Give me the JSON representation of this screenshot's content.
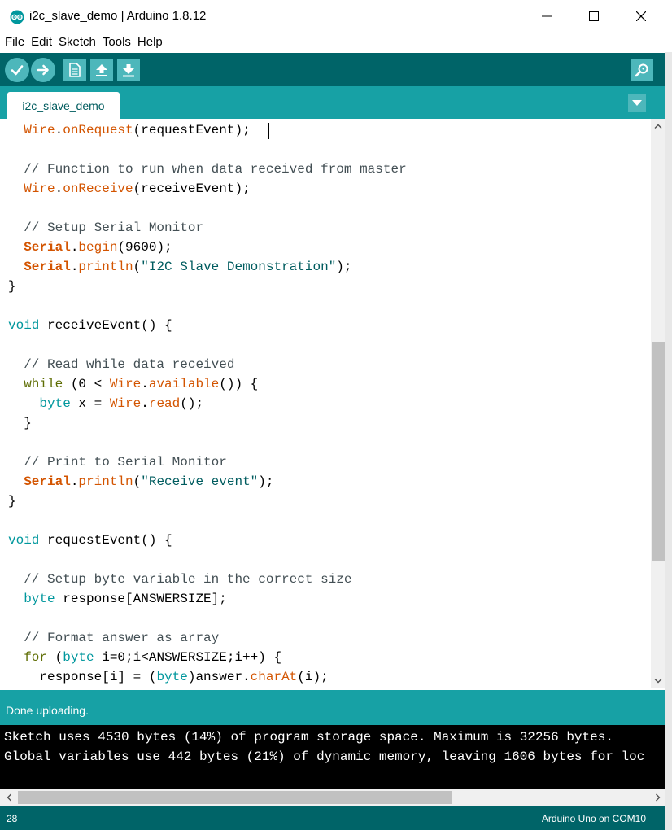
{
  "window": {
    "title": "i2c_slave_demo | Arduino 1.8.12",
    "app_icon": "arduino-logo-icon",
    "controls": [
      "minimize-icon",
      "maximize-icon",
      "close-icon"
    ]
  },
  "menu": {
    "items": [
      {
        "label": "File"
      },
      {
        "label": "Edit"
      },
      {
        "label": "Sketch"
      },
      {
        "label": "Tools"
      },
      {
        "label": "Help"
      }
    ]
  },
  "toolbar": {
    "buttons": [
      {
        "icon": "checkmark-icon",
        "action": "verify"
      },
      {
        "icon": "arrow-right-icon",
        "action": "upload"
      },
      {
        "icon": "new-file-icon",
        "action": "new"
      },
      {
        "icon": "arrow-up-icon",
        "action": "open"
      },
      {
        "icon": "arrow-down-icon",
        "action": "save"
      }
    ],
    "serial_monitor_icon": "magnifier-icon"
  },
  "tabs": {
    "active": "i2c_slave_demo",
    "menu_icon": "triangle-down-icon"
  },
  "editor": {
    "lines": [
      [
        {
          "c": "  "
        },
        {
          "c": "Wire",
          "k": "kw-obj"
        },
        {
          "c": "."
        },
        {
          "c": "onRequest",
          "k": "kw-obj"
        },
        {
          "c": "(requestEvent);"
        }
      ],
      [
        {
          "c": ""
        }
      ],
      [
        {
          "c": "  "
        },
        {
          "c": "// Function to run when data received from master",
          "k": "cm"
        }
      ],
      [
        {
          "c": "  "
        },
        {
          "c": "Wire",
          "k": "kw-obj"
        },
        {
          "c": "."
        },
        {
          "c": "onReceive",
          "k": "kw-obj"
        },
        {
          "c": "(receiveEvent);"
        }
      ],
      [
        {
          "c": ""
        }
      ],
      [
        {
          "c": "  "
        },
        {
          "c": "// Setup Serial Monitor",
          "k": "cm"
        }
      ],
      [
        {
          "c": "  "
        },
        {
          "c": "Serial",
          "k": "kw-obj-b"
        },
        {
          "c": "."
        },
        {
          "c": "begin",
          "k": "kw-obj"
        },
        {
          "c": "(9600);"
        }
      ],
      [
        {
          "c": "  "
        },
        {
          "c": "Serial",
          "k": "kw-obj-b"
        },
        {
          "c": "."
        },
        {
          "c": "println",
          "k": "kw-obj"
        },
        {
          "c": "("
        },
        {
          "c": "\"I2C Slave Demonstration\"",
          "k": "str"
        },
        {
          "c": ");"
        }
      ],
      [
        {
          "c": "}"
        }
      ],
      [
        {
          "c": ""
        }
      ],
      [
        {
          "c": "void",
          "k": "kw-type"
        },
        {
          "c": " receiveEvent() {"
        }
      ],
      [
        {
          "c": ""
        }
      ],
      [
        {
          "c": "  "
        },
        {
          "c": "// Read while data received",
          "k": "cm"
        }
      ],
      [
        {
          "c": "  "
        },
        {
          "c": "while",
          "k": "kw-ctl"
        },
        {
          "c": " (0 < "
        },
        {
          "c": "Wire",
          "k": "kw-obj"
        },
        {
          "c": "."
        },
        {
          "c": "available",
          "k": "kw-obj"
        },
        {
          "c": "()) {"
        }
      ],
      [
        {
          "c": "    "
        },
        {
          "c": "byte",
          "k": "kw-type"
        },
        {
          "c": " x = "
        },
        {
          "c": "Wire",
          "k": "kw-obj"
        },
        {
          "c": "."
        },
        {
          "c": "read",
          "k": "kw-obj"
        },
        {
          "c": "();"
        }
      ],
      [
        {
          "c": "  }"
        }
      ],
      [
        {
          "c": ""
        }
      ],
      [
        {
          "c": "  "
        },
        {
          "c": "// Print to Serial Monitor",
          "k": "cm"
        }
      ],
      [
        {
          "c": "  "
        },
        {
          "c": "Serial",
          "k": "kw-obj-b"
        },
        {
          "c": "."
        },
        {
          "c": "println",
          "k": "kw-obj"
        },
        {
          "c": "("
        },
        {
          "c": "\"Receive event\"",
          "k": "str"
        },
        {
          "c": ");"
        }
      ],
      [
        {
          "c": "}"
        }
      ],
      [
        {
          "c": ""
        }
      ],
      [
        {
          "c": "void",
          "k": "kw-type"
        },
        {
          "c": " requestEvent() {"
        }
      ],
      [
        {
          "c": ""
        }
      ],
      [
        {
          "c": "  "
        },
        {
          "c": "// Setup byte variable in the correct size",
          "k": "cm"
        }
      ],
      [
        {
          "c": "  "
        },
        {
          "c": "byte",
          "k": "kw-type"
        },
        {
          "c": " response[ANSWERSIZE];"
        }
      ],
      [
        {
          "c": ""
        }
      ],
      [
        {
          "c": "  "
        },
        {
          "c": "// Format answer as array",
          "k": "cm"
        }
      ],
      [
        {
          "c": "  "
        },
        {
          "c": "for",
          "k": "kw-ctl"
        },
        {
          "c": " ("
        },
        {
          "c": "byte",
          "k": "kw-type"
        },
        {
          "c": " i=0;i<ANSWERSIZE;i++) {"
        }
      ],
      [
        {
          "c": "    response[i] = ("
        },
        {
          "c": "byte",
          "k": "kw-type"
        },
        {
          "c": ")answer."
        },
        {
          "c": "charAt",
          "k": "kw-obj"
        },
        {
          "c": "(i);"
        }
      ]
    ]
  },
  "status": {
    "message": "Done uploading."
  },
  "console": {
    "lines": [
      "Sketch uses 4530 bytes (14%) of program storage space. Maximum is 32256 bytes.",
      "Global variables use 442 bytes (21%) of dynamic memory, leaving 1606 bytes for loc"
    ]
  },
  "footer": {
    "line_number": "28",
    "board": "Arduino Uno on COM10"
  },
  "colors": {
    "toolbar": "#006468",
    "tabstrip": "#17a1a5",
    "button": "#4db7bb",
    "keyword_type": "#00979d",
    "keyword_object": "#d35400",
    "comment": "#434f54",
    "string": "#005c5f"
  }
}
